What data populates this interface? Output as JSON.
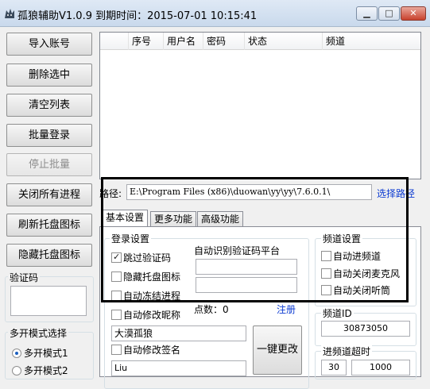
{
  "window": {
    "title": "孤狼辅助V1.0.9  到期时间：2015-07-01 10:15:41",
    "minimize": "▁",
    "maximize": "□",
    "close": "✕"
  },
  "left_buttons": {
    "import": "导入账号",
    "delete_selected": "删除选中",
    "clear_list": "清空列表",
    "batch_login": "批量登录",
    "stop_batch": "停止批量",
    "close_all": "关闭所有进程",
    "refresh_tray": "刷新托盘图标",
    "hide_tray": "隐藏托盘图标"
  },
  "captcha": {
    "title": "验证码"
  },
  "multi_mode": {
    "title": "多开模式选择",
    "options": [
      "多开模式1",
      "多开模式2"
    ],
    "selected": 0
  },
  "account_list": {
    "columns": [
      "序号",
      "用户名",
      "密码",
      "状态",
      "频道"
    ],
    "rows": []
  },
  "path": {
    "label": "路径:",
    "value": "E:\\Program Files (x86)\\duowan\\yy\\yy\\7.6.0.1\\",
    "select_link": "选择路径"
  },
  "tabs": [
    "基本设置",
    "更多功能",
    "高级功能"
  ],
  "active_tab": 0,
  "login_settings": {
    "title": "登录设置",
    "skip_captcha": {
      "label": "跳过验证码",
      "checked": true
    },
    "hide_tray_icon": {
      "label": "隐藏托盘图标",
      "checked": false
    },
    "auto_freeze": {
      "label": "自动冻结进程",
      "checked": false
    }
  },
  "captcha_platform": {
    "label": "自动识别验证码平台",
    "field1": "",
    "field2": ""
  },
  "points": {
    "label": "点数：0",
    "register": "注册"
  },
  "nickname": {
    "label": "自动修改昵称",
    "checked": false,
    "value": "大漠孤狼"
  },
  "signature": {
    "label": "自动修改签名",
    "checked": false,
    "value": "Liu"
  },
  "one_click": "一键更改",
  "channel_settings": {
    "title": "频道设置",
    "auto_enter": {
      "label": "自动进频道",
      "checked": false
    },
    "auto_mute_mic": {
      "label": "自动关闭麦克风",
      "checked": false
    },
    "auto_mute_listen": {
      "label": "自动关闭听筒",
      "checked": false
    }
  },
  "channel_id": {
    "title": "频道ID",
    "value": "30873050"
  },
  "enter_timeout": {
    "title": "进频道超时",
    "value1": "30",
    "value2": "1000"
  }
}
